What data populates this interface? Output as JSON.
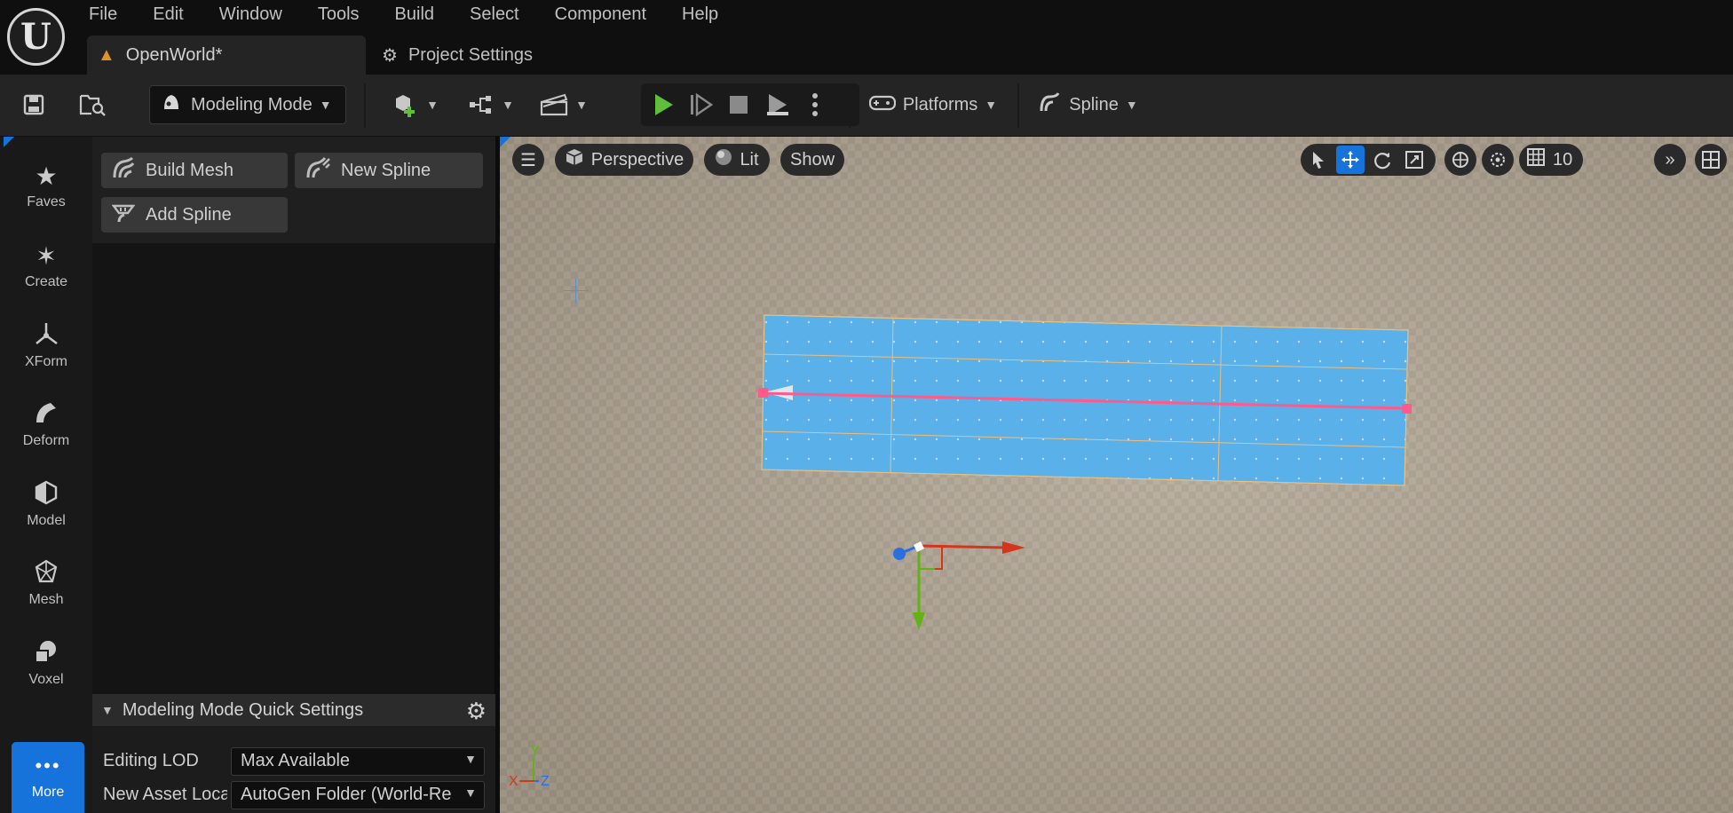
{
  "menu": {
    "items": [
      "File",
      "Edit",
      "Window",
      "Tools",
      "Build",
      "Select",
      "Component",
      "Help"
    ]
  },
  "tabs": {
    "level": "OpenWorld*",
    "project_settings": "Project Settings"
  },
  "toolbar": {
    "mode": "Modeling Mode",
    "platforms": "Platforms",
    "spline": "Spline"
  },
  "modebar": {
    "items": [
      "Faves",
      "Create",
      "XForm",
      "Deform",
      "Model",
      "Mesh",
      "Voxel"
    ],
    "more": "More"
  },
  "palette": {
    "build_mesh": "Build Mesh",
    "new_spline": "New Spline",
    "add_spline": "Add Spline"
  },
  "quick_settings": {
    "title": "Modeling Mode Quick Settings",
    "editing_lod_label": "Editing LOD",
    "editing_lod_value": "Max Available",
    "new_asset_label": "New Asset Loca",
    "new_asset_value": "AutoGen Folder (World-Re"
  },
  "viewport": {
    "perspective": "Perspective",
    "lit": "Lit",
    "show": "Show",
    "grid_size": "10",
    "axis_x": "X",
    "axis_y": "Y",
    "axis_z": "Z"
  },
  "colors": {
    "accent": "#1673dc",
    "play_green": "#5fbf3a",
    "mesh_blue": "#5ab0e8",
    "spline_pink": "#ff5a8a",
    "gizmo_x": "#d2361c",
    "gizmo_y": "#62b212",
    "gizmo_z": "#2a6fe0"
  }
}
